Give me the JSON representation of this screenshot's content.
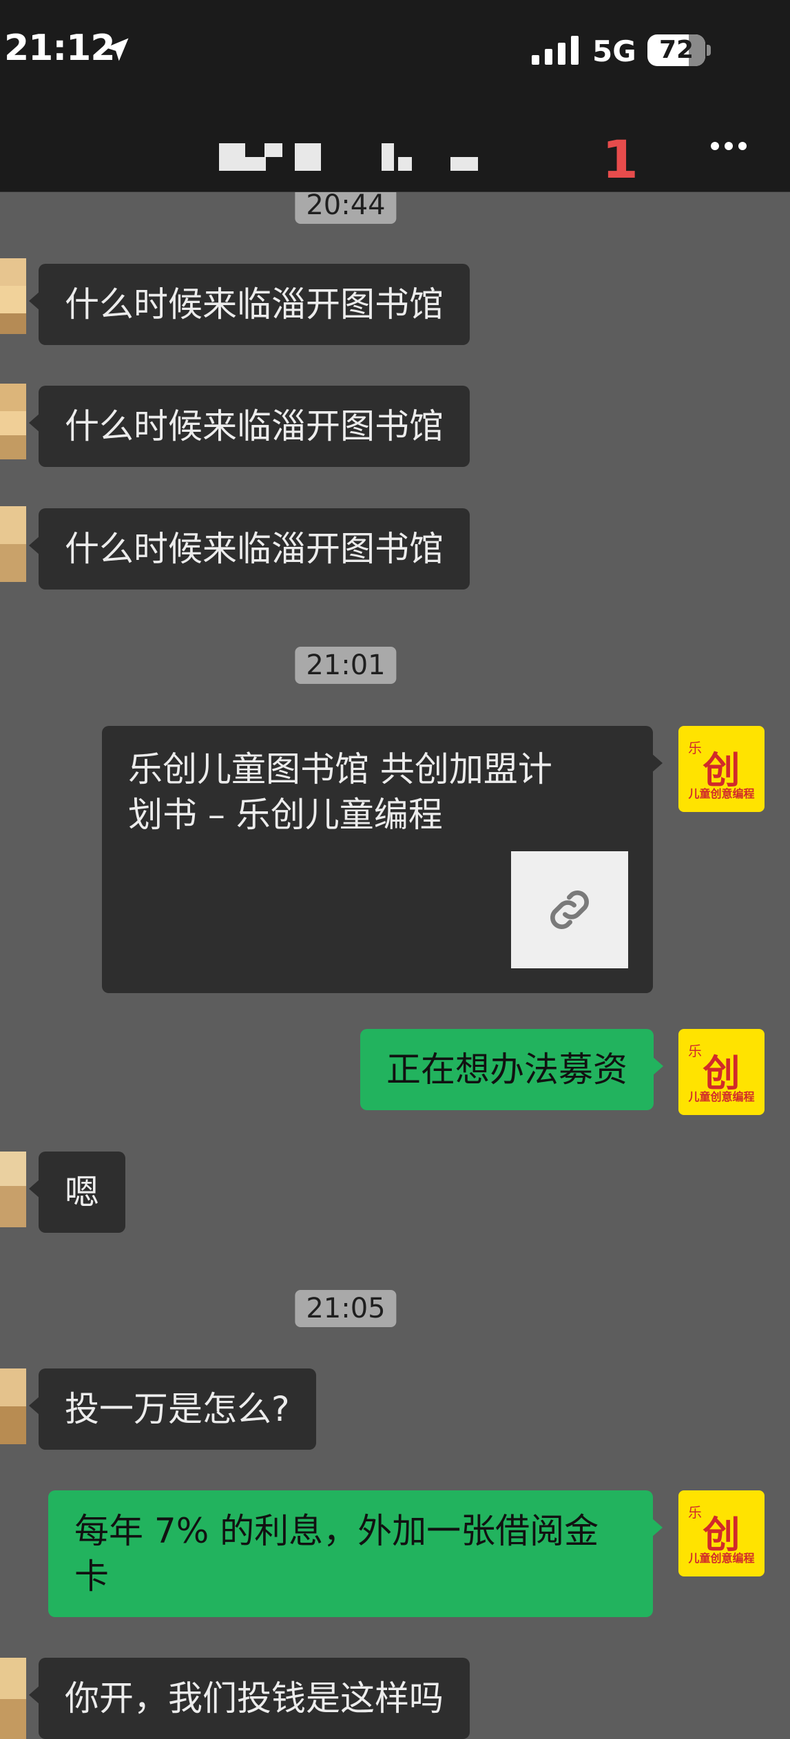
{
  "status_bar": {
    "time": "21:12",
    "network": "5G",
    "battery": "72",
    "location_icon": "location-arrow-icon",
    "signal_icon": "cellular-signal-icon",
    "battery_icon": "battery-icon"
  },
  "nav_bar": {
    "unread_count": "1",
    "more_icon": "more-dots-icon",
    "title_redacted": true
  },
  "colors": {
    "chat_background": "#5d5d5d",
    "incoming_bubble": "#2e2e2e",
    "outgoing_bubble": "#22b35e",
    "timestamp_pill": "#a9a9a9",
    "unread_red": "#e74c4c",
    "brand_avatar_yellow": "#ffe300"
  },
  "avatar_right": {
    "top_text": "乐",
    "main_text": "创",
    "bottom_text": "儿童创意编程"
  },
  "messages": [
    {
      "type": "timestamp",
      "text": "20:44"
    },
    {
      "type": "incoming",
      "text": "什么时候来临淄开图书馆"
    },
    {
      "type": "incoming",
      "text": "什么时候来临淄开图书馆"
    },
    {
      "type": "incoming",
      "text": "什么时候来临淄开图书馆"
    },
    {
      "type": "timestamp",
      "text": "21:01"
    },
    {
      "type": "outgoing_link",
      "title_line1": "乐创儿童图书馆 共创加盟计",
      "title_line2": "划书 – 乐创儿童编程",
      "thumb_icon": "link-icon"
    },
    {
      "type": "outgoing",
      "text": "正在想办法募资"
    },
    {
      "type": "incoming",
      "text": "嗯"
    },
    {
      "type": "timestamp",
      "text": "21:05"
    },
    {
      "type": "incoming",
      "text": "投一万是怎么?"
    },
    {
      "type": "outgoing",
      "line1": "每年 7% 的利息，外加一张借阅金",
      "line2": "卡"
    },
    {
      "type": "incoming",
      "text": "你开，我们投钱是这样吗"
    }
  ]
}
